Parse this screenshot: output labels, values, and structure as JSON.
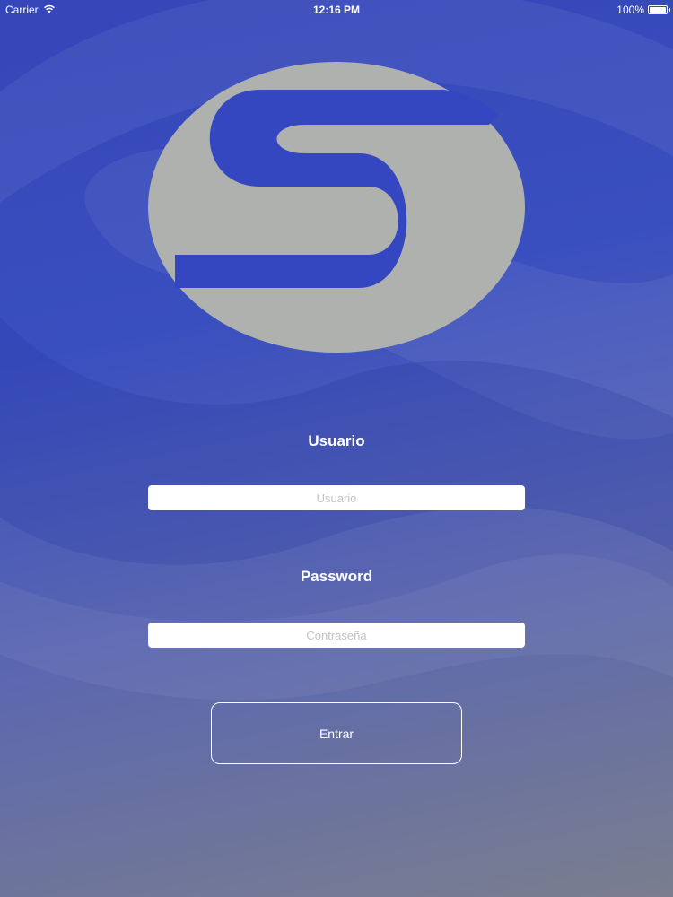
{
  "status_bar": {
    "carrier": "Carrier",
    "time": "12:16 PM",
    "battery": "100%"
  },
  "login": {
    "user_label": "Usuario",
    "user_placeholder": "Usuario",
    "password_label": "Password",
    "password_placeholder": "Contraseña",
    "submit_label": "Entrar"
  },
  "colors": {
    "background_top": "#3546b8",
    "background_bottom": "#7a7e8e",
    "logo_fill": "#aeb1ad",
    "text": "#ffffff"
  },
  "icons": [
    "wifi-icon",
    "battery-icon",
    "s-logo"
  ]
}
